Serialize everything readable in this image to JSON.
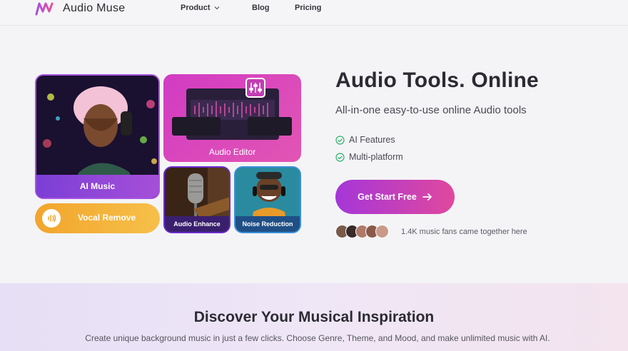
{
  "nav": {
    "brand": "Audio Muse",
    "links": {
      "product": "Product",
      "blog": "Blog",
      "pricing": "Pricing"
    }
  },
  "tools": {
    "ai_music": "AI Music",
    "audio_editor": "Audio Editor",
    "audio_enhance": "Audio Enhance",
    "noise_reduction": "Noise Reduction",
    "vocal_remove": "Vocal Remove"
  },
  "hero": {
    "title": "Audio Tools. Online",
    "subtitle": "All-in-one easy-to-use online Audio tools",
    "features": [
      "AI Features",
      "Multi-platform"
    ],
    "cta": "Get Start Free",
    "fans_text": "1.4K music fans came together here"
  },
  "discover": {
    "title": "Discover Your Musical Inspiration",
    "subtitle": "Create unique background music in just a few clicks. Choose Genre, Theme, and Mood, and make unlimited music with AI."
  },
  "colors": {
    "brand_gradient_start": "#a536d8",
    "brand_gradient_end": "#e0489e",
    "check_green": "#2fb36b",
    "vocal_orange": "#f2a52c"
  },
  "icons": [
    "logo-icon",
    "chevron-down-icon",
    "check-icon",
    "arrow-right-icon",
    "sound-wave-icon",
    "equalizer-icon"
  ]
}
